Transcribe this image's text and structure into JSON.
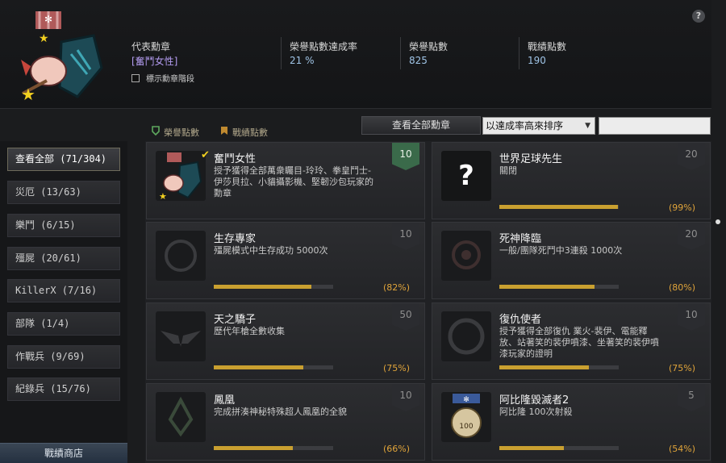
{
  "header": {
    "rep_medal_label": "代表勳章",
    "rep_medal_value": "[奮鬥女性]",
    "show_rank_label": "標示勳章階段",
    "honor_rate_label": "榮譽點數達成率",
    "honor_rate_value": "21 %",
    "honor_points_label": "榮譽點數",
    "honor_points_value": "825",
    "battle_points_label": "戰績點數",
    "battle_points_value": "190",
    "help": "?"
  },
  "legend": {
    "honor": "榮譽點數",
    "battle": "戰績點數"
  },
  "toolbar": {
    "view_all": "查看全部勳章",
    "sort_value": "以達成率高來排序",
    "sort_arrow": "▼"
  },
  "sidebar": {
    "items": [
      {
        "label": "查看全部 (71/304)"
      },
      {
        "label": "災厄 (13/63)"
      },
      {
        "label": "樂鬥 (6/15)"
      },
      {
        "label": "殭屍 (20/61)"
      },
      {
        "label": "KillerX (7/16)"
      },
      {
        "label": "部隊 (1/4)"
      },
      {
        "label": "作戰兵 (9/69)"
      },
      {
        "label": "紀錄兵 (15/76)"
      }
    ],
    "shop": "戰績商店"
  },
  "medals": [
    {
      "title": "奮鬥女性",
      "desc": "授予獲得全部萬衆矚目-玲玲、拳皇鬥士-伊莎貝拉、小貓攝影機、堅韌沙包玩家的勳章",
      "points": "10",
      "progress": null,
      "pct": "",
      "gained": true,
      "icon": "medal-icon"
    },
    {
      "title": "世界足球先生",
      "desc": "關閉",
      "points": "20",
      "progress": 0.99,
      "pct": "(99%)",
      "gained": false,
      "icon": "question-icon"
    },
    {
      "title": "生存專家",
      "desc": "殭屍模式中生存成功 5000次",
      "points": "10",
      "progress": 0.82,
      "pct": "(82%)",
      "gained": false,
      "icon": "survival-icon"
    },
    {
      "title": "死神降臨",
      "desc": "一般/團隊死鬥中3連殺 1000次",
      "points": "20",
      "progress": 0.8,
      "pct": "(80%)",
      "gained": false,
      "icon": "reaper-icon"
    },
    {
      "title": "天之驕子",
      "desc": "歷代年槍全數收集",
      "points": "50",
      "progress": 0.75,
      "pct": "(75%)",
      "gained": false,
      "icon": "wings-icon"
    },
    {
      "title": "復仇使者",
      "desc": "授予獲得全部復仇 業火-裴伊、電能釋放、站著笑的裴伊噴漆、坐著笑的裴伊噴漆玩家的證明",
      "points": "10",
      "progress": 0.75,
      "pct": "(75%)",
      "gained": false,
      "icon": "avenger-icon"
    },
    {
      "title": "鳳凰",
      "desc": "完成拼湊神秘特殊超人鳳凰的全貌",
      "points": "10",
      "progress": 0.66,
      "pct": "(66%)",
      "gained": false,
      "icon": "phoenix-icon"
    },
    {
      "title": "阿比隆毀滅者2",
      "desc": "阿比隆 100次射殺",
      "points": "5",
      "progress": 0.54,
      "pct": "(54%)",
      "gained": false,
      "icon": "abilon-icon"
    }
  ],
  "colors": {
    "accent_gold": "#c9a030",
    "pct_orange": "#e0a43a",
    "rep_medal_purple": "#b39cf0",
    "stat_blue": "#9fc4e6"
  }
}
